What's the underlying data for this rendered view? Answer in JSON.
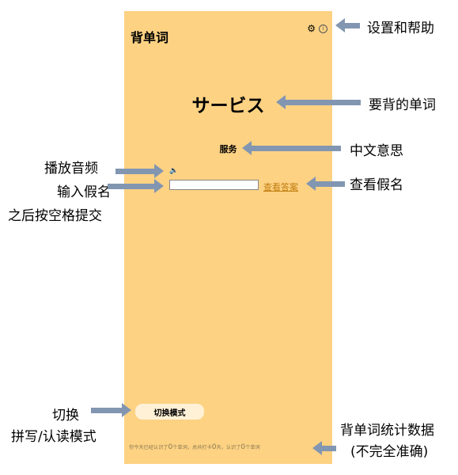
{
  "app": {
    "title": "背单词",
    "settings_icon": "gear-icon",
    "info_icon": "info-circle-icon",
    "info_glyph": "i",
    "word": "サービス",
    "meaning": "服务",
    "audio_icon": "speaker-icon",
    "kana_input_value": "",
    "show_answer_label": "查看答案",
    "switch_mode_label": "切换模式",
    "stats": {
      "p1": "你今天已经认识了",
      "today_count": "0",
      "p2": "个单词，总共打卡",
      "days": "0",
      "p3": "天，认识了",
      "total_count": "0",
      "p4": "个单词"
    }
  },
  "annotations": {
    "settings_help": "设置和帮助",
    "word_to_learn": "要背的单词",
    "chinese_meaning": "中文意思",
    "play_audio": "播放音频",
    "input_kana_line1": "输入假名",
    "input_kana_line2": "之后按空格提交",
    "view_kana": "查看假名",
    "switch_line1": "切换",
    "switch_line2": "拼写/认读模式",
    "stats_line1": "背单词统计数据",
    "stats_line2": "(不完全准确)"
  },
  "colors": {
    "app_background": "#fdd283",
    "arrow": "#8296b1",
    "link": "#c27c0e",
    "button_background": "#fff1d6"
  }
}
